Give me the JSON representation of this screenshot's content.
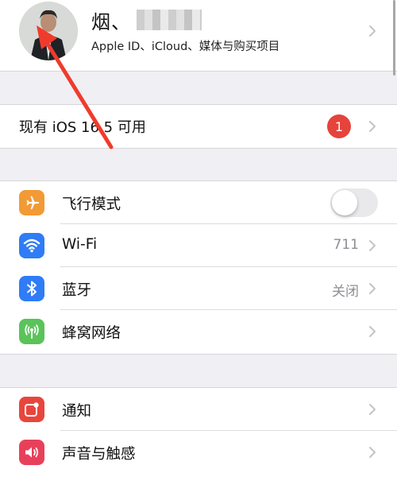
{
  "profile": {
    "name": "烟、",
    "subtitle": "Apple ID、iCloud、媒体与购买项目"
  },
  "update": {
    "label": "现有 iOS 16.5 可用",
    "badge_count": "1"
  },
  "settings": [
    {
      "label": "飞行模式",
      "icon": "airplane-icon",
      "color": "#f29a35",
      "toggle_on": false
    },
    {
      "label": "Wi-Fi",
      "icon": "wifi-icon",
      "color": "#2f7cf6",
      "value": "711"
    },
    {
      "label": "蓝牙",
      "icon": "bluetooth-icon",
      "color": "#2f7cf6",
      "value": "关闭"
    },
    {
      "label": "蜂窝网络",
      "icon": "cellular-antenna-icon",
      "color": "#5ac35a"
    }
  ],
  "settings2": [
    {
      "label": "通知",
      "icon": "notification-icon",
      "color": "#e8463d"
    },
    {
      "label": "声音与触感",
      "icon": "speaker-icon",
      "color": "#e9405a"
    }
  ],
  "annotation": {
    "arrow_color": "#ef3b2c"
  }
}
